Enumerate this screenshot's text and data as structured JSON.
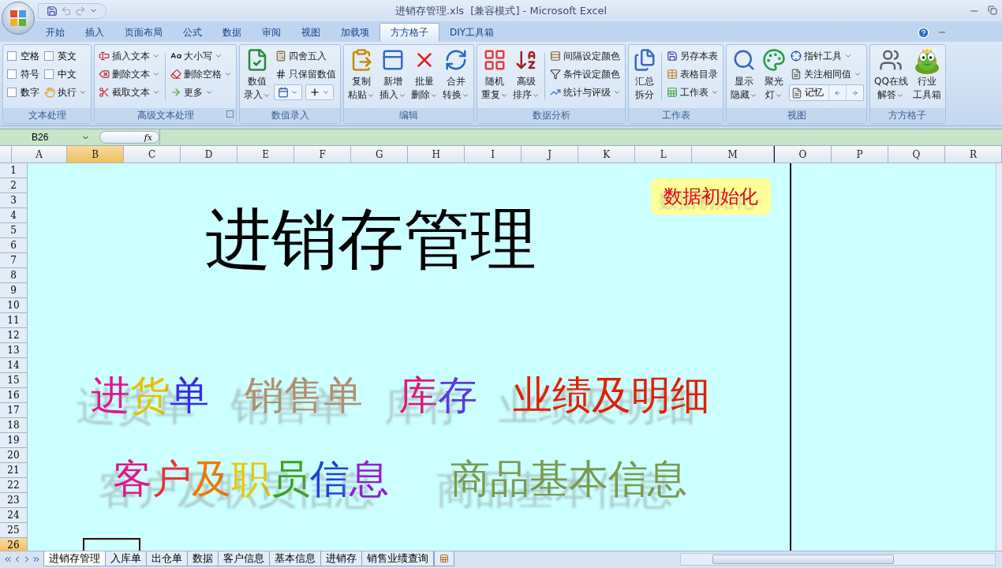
{
  "window": {
    "title": "进销存管理.xls  [兼容模式] - Microsoft Excel"
  },
  "tabs": [
    {
      "label": "开始",
      "selected": false
    },
    {
      "label": "插入",
      "selected": false
    },
    {
      "label": "页面布局",
      "selected": false
    },
    {
      "label": "公式",
      "selected": false
    },
    {
      "label": "数据",
      "selected": false
    },
    {
      "label": "审阅",
      "selected": false
    },
    {
      "label": "视图",
      "selected": false
    },
    {
      "label": "加载项",
      "selected": false
    },
    {
      "label": "方方格子",
      "selected": true
    },
    {
      "label": "DIY工具箱",
      "selected": false
    }
  ],
  "ribbon": {
    "groups": [
      {
        "label": "文本处理",
        "launcher": false,
        "columns": [
          {
            "kind": "stack",
            "items": [
              {
                "kind": "check",
                "label": "空格",
                "checked": false
              },
              {
                "kind": "check",
                "label": "符号",
                "checked": false
              },
              {
                "kind": "check",
                "label": "数字",
                "checked": false
              }
            ]
          },
          {
            "kind": "stack",
            "items": [
              {
                "kind": "check",
                "label": "英文",
                "checked": false
              },
              {
                "kind": "check",
                "label": "中文",
                "checked": false
              },
              {
                "kind": "small",
                "label": "执行",
                "menu": true
              }
            ]
          }
        ]
      },
      {
        "label": "高级文本处理",
        "launcher": true,
        "columns": [
          {
            "kind": "stack",
            "items": [
              {
                "kind": "small",
                "label": "插入文本",
                "menu": true
              },
              {
                "kind": "small",
                "label": "删除文本",
                "menu": true
              },
              {
                "kind": "small",
                "label": "截取文本",
                "menu": true
              }
            ]
          },
          {
            "kind": "separator"
          },
          {
            "kind": "stack",
            "items": [
              {
                "kind": "small",
                "label": "大小写",
                "menu": true
              },
              {
                "kind": "small",
                "label": "删除空格",
                "menu": true
              },
              {
                "kind": "small",
                "label": "更多",
                "menu": true
              }
            ]
          }
        ]
      },
      {
        "label": "数值录入",
        "launcher": false,
        "columns": [
          {
            "kind": "large",
            "lines": [
              "数值",
              "录入"
            ],
            "menu": true
          },
          {
            "kind": "stack",
            "items": [
              {
                "kind": "small",
                "label": "四舍五入",
                "menu": false
              },
              {
                "kind": "small",
                "label": "只保留数值",
                "menu": false
              },
              {
                "kind": "iconpair"
              }
            ]
          }
        ]
      },
      {
        "label": "编辑",
        "launcher": false,
        "columns": [
          {
            "kind": "large",
            "lines": [
              "复制",
              "粘贴"
            ],
            "menu": true
          },
          {
            "kind": "large",
            "lines": [
              "新增",
              "插入"
            ],
            "menu": true
          },
          {
            "kind": "large",
            "lines": [
              "批量",
              "删除"
            ],
            "menu": true
          },
          {
            "kind": "large",
            "lines": [
              "合并",
              "转换"
            ],
            "menu": true
          }
        ]
      },
      {
        "label": "数据分析",
        "launcher": false,
        "columns": [
          {
            "kind": "large",
            "lines": [
              "随机",
              "重复"
            ],
            "menu": true
          },
          {
            "kind": "large",
            "lines": [
              "高级",
              "排序"
            ],
            "menu": true
          },
          {
            "kind": "separator"
          },
          {
            "kind": "stack",
            "items": [
              {
                "kind": "small",
                "label": "间隔设定颜色",
                "menu": false
              },
              {
                "kind": "small",
                "label": "条件设定颜色",
                "menu": false
              },
              {
                "kind": "small",
                "label": "统计与评级",
                "menu": true
              }
            ]
          }
        ]
      },
      {
        "label": "工作表",
        "launcher": false,
        "columns": [
          {
            "kind": "large",
            "lines": [
              "汇总",
              "拆分"
            ],
            "menu": false
          },
          {
            "kind": "separator"
          },
          {
            "kind": "stack",
            "items": [
              {
                "kind": "small",
                "label": "另存本表",
                "menu": false
              },
              {
                "kind": "small",
                "label": "表格目录",
                "menu": false
              },
              {
                "kind": "small",
                "label": "工作表",
                "menu": true
              }
            ]
          }
        ]
      },
      {
        "label": "视图",
        "launcher": false,
        "columns": [
          {
            "kind": "large",
            "lines": [
              "显示",
              "隐藏"
            ],
            "menu": true
          },
          {
            "kind": "large",
            "lines": [
              "聚光",
              "灯"
            ],
            "menu": true
          },
          {
            "kind": "stack",
            "items": [
              {
                "kind": "small",
                "label": "指针工具",
                "menu": true
              },
              {
                "kind": "small",
                "label": "关注相同值",
                "menu": true
              },
              {
                "kind": "nav",
                "label": "记忆"
              }
            ]
          }
        ]
      },
      {
        "label": "方方格子",
        "launcher": false,
        "columns": [
          {
            "kind": "large",
            "lines": [
              "QQ在线",
              "解答"
            ],
            "menu": true
          },
          {
            "kind": "large",
            "lines": [
              "行业",
              "工具箱"
            ],
            "menu": false
          }
        ]
      }
    ]
  },
  "formula_bar": {
    "name_box": "B26",
    "fx": "fx"
  },
  "columns": [
    {
      "label": "A",
      "selected": false
    },
    {
      "label": "B",
      "selected": true
    },
    {
      "label": "C",
      "selected": false
    },
    {
      "label": "D",
      "selected": false
    },
    {
      "label": "E",
      "selected": false
    },
    {
      "label": "F",
      "selected": false
    },
    {
      "label": "G",
      "selected": false
    },
    {
      "label": "H",
      "selected": false
    },
    {
      "label": "I",
      "selected": false
    },
    {
      "label": "J",
      "selected": false
    },
    {
      "label": "K",
      "selected": false
    },
    {
      "label": "L",
      "selected": false
    },
    {
      "label": "M",
      "selected": false
    },
    {
      "label": "O",
      "selected": false
    },
    {
      "label": "P",
      "selected": false
    },
    {
      "label": "Q",
      "selected": false
    },
    {
      "label": "R",
      "selected": false
    }
  ],
  "rows": [
    {
      "label": "1",
      "selected": false
    },
    {
      "label": "2",
      "selected": false
    },
    {
      "label": "3",
      "selected": false
    },
    {
      "label": "4",
      "selected": false
    },
    {
      "label": "5",
      "selected": false
    },
    {
      "label": "6",
      "selected": false
    },
    {
      "label": "7",
      "selected": false
    },
    {
      "label": "8",
      "selected": false
    },
    {
      "label": "9",
      "selected": false
    },
    {
      "label": "10",
      "selected": false
    },
    {
      "label": "11",
      "selected": false
    },
    {
      "label": "12",
      "selected": false
    },
    {
      "label": "13",
      "selected": false
    },
    {
      "label": "14",
      "selected": false
    },
    {
      "label": "15",
      "selected": false
    },
    {
      "label": "16",
      "selected": false
    },
    {
      "label": "17",
      "selected": false
    },
    {
      "label": "18",
      "selected": false
    },
    {
      "label": "19",
      "selected": false
    },
    {
      "label": "20",
      "selected": false
    },
    {
      "label": "21",
      "selected": false
    },
    {
      "label": "22",
      "selected": false
    },
    {
      "label": "23",
      "selected": false
    },
    {
      "label": "24",
      "selected": false
    },
    {
      "label": "25",
      "selected": false
    },
    {
      "label": "26",
      "selected": true
    }
  ],
  "sheet": {
    "title": "进销存管理",
    "button": "数据初始化",
    "link_rows": [
      [
        {
          "chars": [
            {
              "text": "进",
              "color": "#e0188a"
            },
            {
              "text": "货",
              "color": "#e8c000"
            },
            {
              "text": "单",
              "color": "#3a2ce0"
            }
          ]
        },
        {
          "chars": [
            {
              "text": "销售单",
              "color": "#b09070"
            }
          ]
        },
        {
          "chars": [
            {
              "text": "库",
              "color": "#e01878"
            },
            {
              "text": "存",
              "color": "#5a3ae0"
            }
          ]
        },
        {
          "chars": [
            {
              "text": "业绩及明细",
              "color": "#e02000"
            }
          ]
        }
      ],
      [
        {
          "chars": [
            {
              "text": "客",
              "color": "#e01888"
            },
            {
              "text": "户",
              "color": "#f03030"
            },
            {
              "text": "及",
              "color": "#f07800"
            },
            {
              "text": "职",
              "color": "#e8c800"
            },
            {
              "text": "员",
              "color": "#40a020"
            },
            {
              "text": "信",
              "color": "#2040e0"
            },
            {
              "text": "息",
              "color": "#9020d0"
            }
          ]
        },
        {
          "chars": [
            {
              "text": "商品基本信息",
              "color": "#7a9a50"
            }
          ]
        }
      ]
    ]
  },
  "sheet_tabs": [
    {
      "label": "进销存管理",
      "selected": true
    },
    {
      "label": "入库单",
      "selected": false
    },
    {
      "label": "出仓单",
      "selected": false
    },
    {
      "label": "数据",
      "selected": false
    },
    {
      "label": "客户信息",
      "selected": false
    },
    {
      "label": "基本信息",
      "selected": false
    },
    {
      "label": "进销存",
      "selected": false
    },
    {
      "label": "销售业绩查询",
      "selected": false
    }
  ]
}
